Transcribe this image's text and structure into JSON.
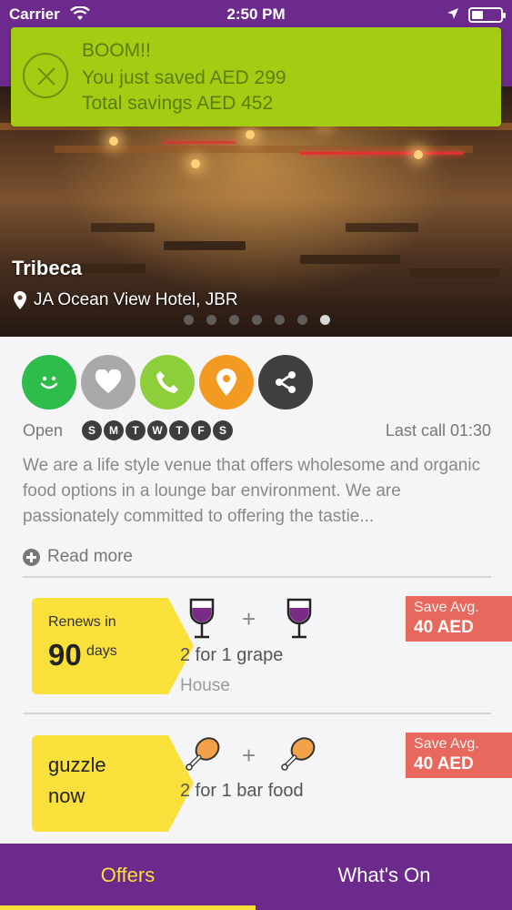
{
  "status_bar": {
    "carrier": "Carrier",
    "time": "2:50 PM"
  },
  "toast": {
    "line1": "BOOM!!",
    "line2": "You just saved AED 299",
    "line3": "Total savings AED 452"
  },
  "venue": {
    "name": "Tribeca",
    "location": "JA Ocean View Hotel, JBR",
    "carousel": {
      "pages": 7,
      "active_index": 6
    }
  },
  "actions": [
    {
      "icon": "smile-icon",
      "color": "#2ebd4a"
    },
    {
      "icon": "heart-icon",
      "color": "#a9a9a9"
    },
    {
      "icon": "phone-icon",
      "color": "#8ccf3a"
    },
    {
      "icon": "map-pin-icon",
      "color": "#f39a22"
    },
    {
      "icon": "share-icon",
      "color": "#3f3f40"
    }
  ],
  "hours": {
    "open_label": "Open",
    "days": [
      "S",
      "M",
      "T",
      "W",
      "T",
      "F",
      "S"
    ],
    "last_call": "Last call 01:30"
  },
  "description": "We are a life style venue that offers wholesome and organic food options in a lounge bar environment. We are passionately committed to offering the tastie...",
  "read_more": "Read more",
  "offers": [
    {
      "tag_line1": "Renews in",
      "tag_number": "90",
      "tag_unit": "days",
      "title": "2 for 1 grape",
      "subtitle": "House",
      "icon": "wine-glass-icon",
      "save_label": "Save Avg.",
      "save_value": "40 AED"
    },
    {
      "tag_line1": "guzzle",
      "tag_line2": "now",
      "title": "2 for 1 bar food",
      "icon": "chicken-leg-icon",
      "save_label": "Save Avg.",
      "save_value": "40 AED"
    }
  ],
  "plus_sign": "+",
  "tabs": {
    "offers": "Offers",
    "whats_on": "What's On",
    "active": "offers"
  },
  "colors": {
    "brand_purple": "#6b2a8c",
    "toast_green": "#a3cc12",
    "tag_yellow": "#f9e03b",
    "save_red": "#e8685d"
  }
}
